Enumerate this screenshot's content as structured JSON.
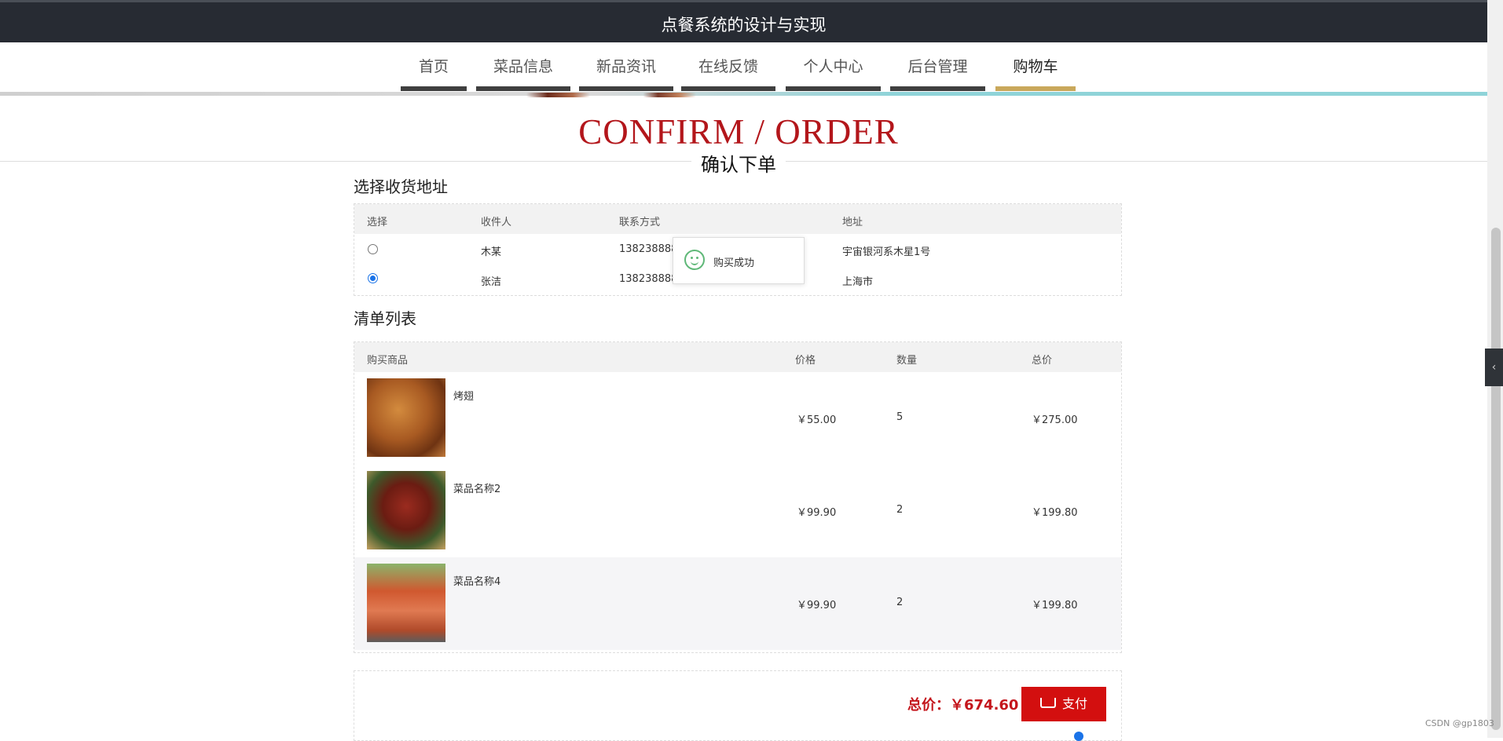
{
  "header": {
    "title": "点餐系统的设计与实现"
  },
  "nav": {
    "items": [
      {
        "label": "首页"
      },
      {
        "label": "菜品信息"
      },
      {
        "label": "新品资讯"
      },
      {
        "label": "在线反馈"
      },
      {
        "label": "个人中心"
      },
      {
        "label": "后台管理"
      },
      {
        "label": "购物车"
      }
    ],
    "active_index": 6
  },
  "heading": {
    "en": "CONFIRM / ORDER",
    "cn": "确认下单"
  },
  "address_section": {
    "title": "选择收货地址",
    "columns": [
      "选择",
      "收件人",
      "联系方式",
      "地址"
    ],
    "rows": [
      {
        "selected": false,
        "name": "木某",
        "phone": "13823888888",
        "address": "宇宙银河系木星1号"
      },
      {
        "selected": true,
        "name": "张洁",
        "phone": "13823888888",
        "address": "上海市"
      }
    ]
  },
  "toast": {
    "message": "购买成功",
    "icon": "smile-icon"
  },
  "order_section": {
    "title": "清单列表",
    "columns": [
      "购买商品",
      "价格",
      "数量",
      "总价"
    ],
    "items": [
      {
        "name": "烤翅",
        "price": "￥55.00",
        "qty": "5",
        "total": "￥275.00",
        "image": "wings"
      },
      {
        "name": "菜品名称2",
        "price": "￥99.90",
        "qty": "2",
        "total": "￥199.80",
        "image": "shrimp"
      },
      {
        "name": "菜品名称4",
        "price": "￥99.90",
        "qty": "2",
        "total": "￥199.80",
        "image": "salmon"
      }
    ]
  },
  "summary": {
    "total_label": "总价：",
    "total_value": "￥674.60",
    "pay_label": "支付"
  },
  "side_tab": {
    "glyph": "‹"
  },
  "watermark": "CSDN @gp1803",
  "colors": {
    "accent_red": "#c4161c",
    "nav_active": "#c9a85b",
    "topbar": "#272b33"
  }
}
